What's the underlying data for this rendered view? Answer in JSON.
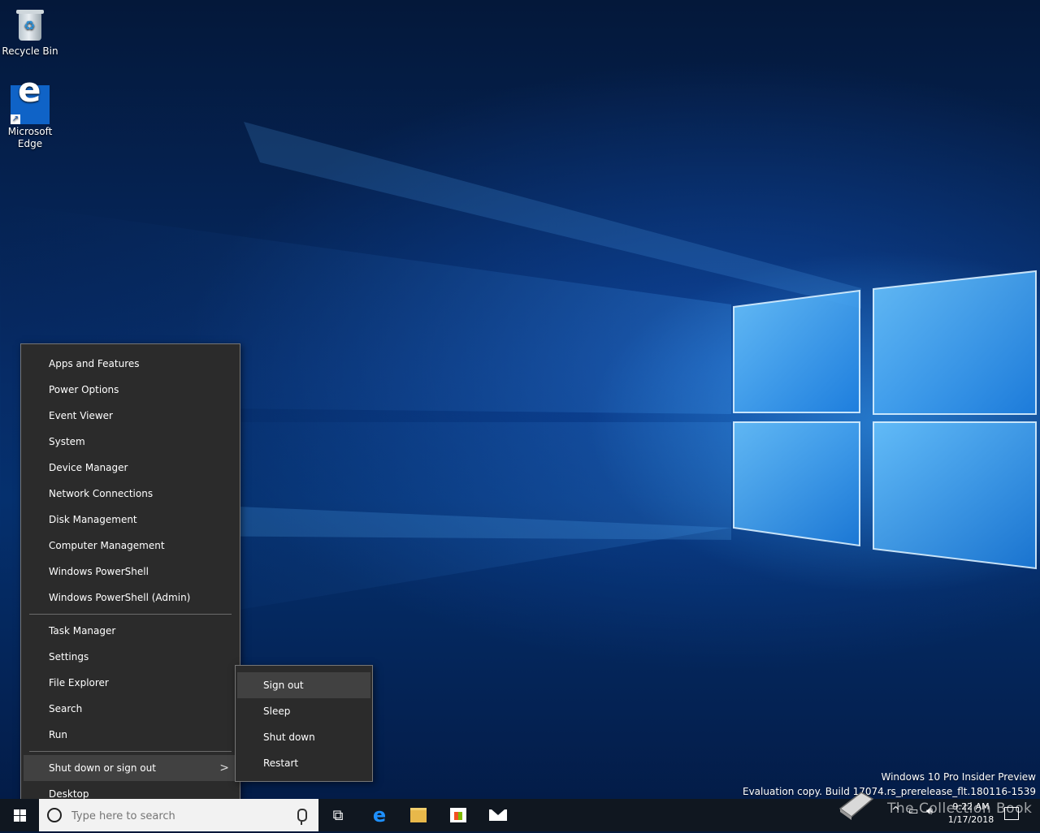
{
  "desktop": {
    "icons": [
      {
        "label": "Recycle Bin",
        "icon": "recycle-bin-icon"
      },
      {
        "label": "Microsoft Edge",
        "icon": "edge-icon"
      }
    ]
  },
  "winx_menu": {
    "group1": [
      "Apps and Features",
      "Power Options",
      "Event Viewer",
      "System",
      "Device Manager",
      "Network Connections",
      "Disk Management",
      "Computer Management",
      "Windows PowerShell",
      "Windows PowerShell (Admin)"
    ],
    "group2": [
      "Task Manager",
      "Settings",
      "File Explorer",
      "Search",
      "Run"
    ],
    "shutdown": "Shut down or sign out",
    "desktop": "Desktop"
  },
  "submenu": {
    "items": [
      "Sign out",
      "Sleep",
      "Shut down",
      "Restart"
    ],
    "hovered": "Sign out"
  },
  "watermark": {
    "line1": "Windows 10 Pro Insider Preview",
    "line2": "Evaluation copy. Build 17074.rs_prerelease_flt.180116-1539"
  },
  "taskbar": {
    "search_placeholder": "Type here to search",
    "time": "9:22 AM",
    "date": "1/17/2018",
    "overlay_text": "The Collection Book"
  }
}
